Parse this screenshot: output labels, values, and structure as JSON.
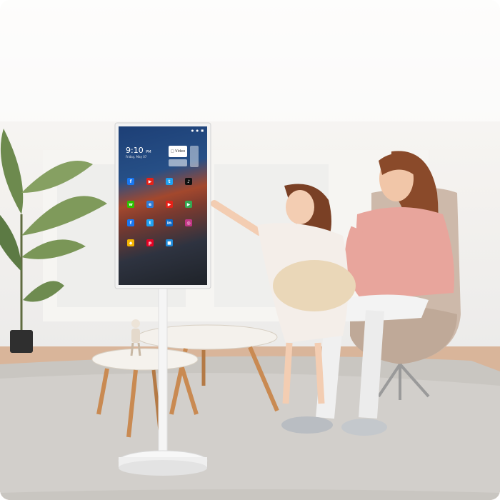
{
  "tablet": {
    "status_bar": "● ● ■",
    "clock_time": "9:10",
    "clock_ampm": "PM",
    "date": "Friday, May 07",
    "widget_label": "□ Video"
  },
  "apps": [
    {
      "icon": "facebook-icon",
      "glyph": "f",
      "color": "#1877f2"
    },
    {
      "icon": "youtube-icon",
      "glyph": "▶",
      "color": "#e62117"
    },
    {
      "icon": "twitter-icon",
      "glyph": "t",
      "color": "#1da1f2"
    },
    {
      "icon": "tiktok-icon",
      "glyph": "♪",
      "color": "#111111"
    },
    {
      "icon": "wechat-icon",
      "glyph": "w",
      "color": "#2dc100"
    },
    {
      "icon": "browser-icon",
      "glyph": "e",
      "color": "#2e7bd6"
    },
    {
      "icon": "youtube-icon",
      "glyph": "▶",
      "color": "#e62117"
    },
    {
      "icon": "play-store-icon",
      "glyph": "▶",
      "color": "#34a853"
    },
    {
      "icon": "facebook-icon",
      "glyph": "f",
      "color": "#1877f2"
    },
    {
      "icon": "twitter-icon",
      "glyph": "t",
      "color": "#1da1f2"
    },
    {
      "icon": "linkedin-icon",
      "glyph": "in",
      "color": "#0a66c2"
    },
    {
      "icon": "instagram-icon",
      "glyph": "◎",
      "color": "#c13584"
    },
    {
      "icon": "maps-icon",
      "glyph": "◆",
      "color": "#f4b400"
    },
    {
      "icon": "pinterest-icon",
      "glyph": "p",
      "color": "#e60023"
    },
    {
      "icon": "app-icon",
      "glyph": "■",
      "color": "#1f8ad9"
    }
  ]
}
